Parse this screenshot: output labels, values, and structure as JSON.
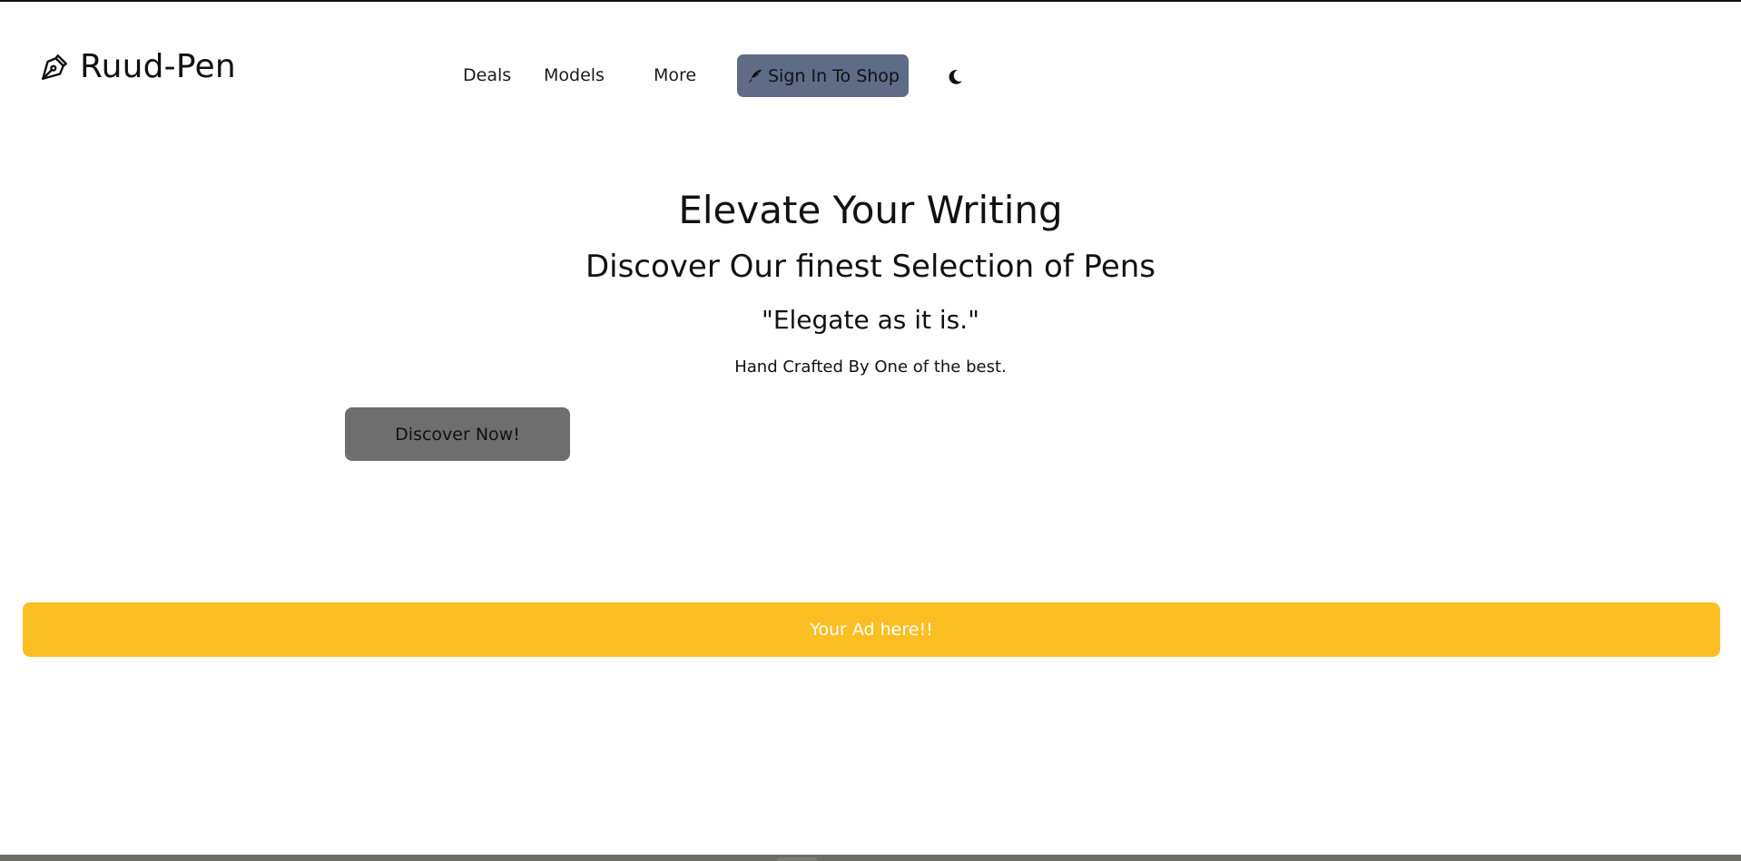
{
  "brand": {
    "name": "Ruud-Pen",
    "icon": "pen-nib-icon"
  },
  "nav": {
    "items": [
      {
        "label": "Deals"
      },
      {
        "label": "Models"
      },
      {
        "label": "More"
      }
    ],
    "signin": {
      "label": "Sign In To Shop",
      "icon": "feather-icon",
      "color": "#5e6c87"
    },
    "theme_toggle_icon": "moon-icon"
  },
  "hero": {
    "title": "Elevate Your Writing",
    "subtitle": "Discover Our finest Selection of Pens",
    "quote": "\"Elegate as it is.\"",
    "tagline": "Hand Crafted By One of the best.",
    "cta_label": "Discover Now!",
    "cta_color": "#6e6e6e"
  },
  "ad": {
    "text": "Your Ad here!!",
    "color": "#fbbf24"
  }
}
